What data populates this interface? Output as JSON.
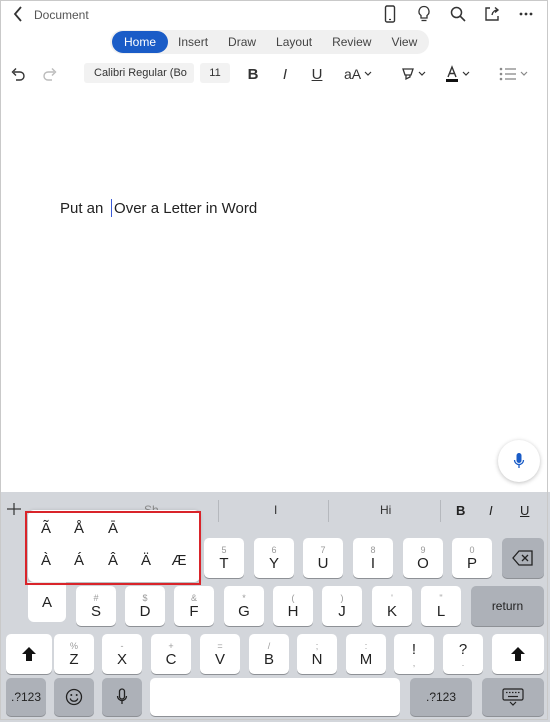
{
  "header": {
    "title": "Document"
  },
  "tabs": [
    "Home",
    "Insert",
    "Draw",
    "Layout",
    "Review",
    "View"
  ],
  "toolbar": {
    "font_name": "Calibri Regular (Bo",
    "font_size": "11",
    "font_size_button": "aA"
  },
  "document": {
    "text_before": "Put an ",
    "text_after": "Over a Letter in Word"
  },
  "keyboard": {
    "suggestions": [
      "I",
      "Hi"
    ],
    "suggestion_partial": "Sh",
    "format": {
      "bold": "B",
      "italic": "I",
      "underline": "U"
    },
    "popup_row1": [
      "Ã",
      "Å",
      "Ā"
    ],
    "popup_row2": [
      "À",
      "Á",
      "Â",
      "Ä",
      "Æ"
    ],
    "row1": [
      {
        "pri": "T",
        "sec": "5"
      },
      {
        "pri": "Y",
        "sec": "6"
      },
      {
        "pri": "U",
        "sec": "7"
      },
      {
        "pri": "I",
        "sec": "8"
      },
      {
        "pri": "O",
        "sec": "9"
      },
      {
        "pri": "P",
        "sec": "0"
      }
    ],
    "row2": [
      {
        "pri": "S",
        "sec": "#"
      },
      {
        "pri": "D",
        "sec": "$"
      },
      {
        "pri": "F",
        "sec": "&"
      },
      {
        "pri": "G",
        "sec": "*"
      },
      {
        "pri": "H",
        "sec": "("
      },
      {
        "pri": "J",
        "sec": ")"
      },
      {
        "pri": "K",
        "sec": "'"
      },
      {
        "pri": "L",
        "sec": "\""
      }
    ],
    "row3": [
      {
        "pri": "Z",
        "sec": "%"
      },
      {
        "pri": "X",
        "sec": "-"
      },
      {
        "pri": "C",
        "sec": "+"
      },
      {
        "pri": "V",
        "sec": "="
      },
      {
        "pri": "B",
        "sec": "/"
      },
      {
        "pri": "N",
        "sec": ";"
      },
      {
        "pri": "M",
        "sec": ":"
      },
      {
        "pri": "!",
        "sec": ","
      },
      {
        "pri": "?",
        "sec": "."
      }
    ],
    "a_key": "A",
    "return_label": "return",
    "numbers_label": ".?123",
    "icons": [
      "backspace-icon",
      "shift-icon",
      "emoji-icon",
      "microphone-icon",
      "keyboard-dismiss-icon"
    ]
  },
  "colors": {
    "accent": "#1a5cc7",
    "highlight": "#d9242a",
    "caret": "#3b5bd6"
  }
}
